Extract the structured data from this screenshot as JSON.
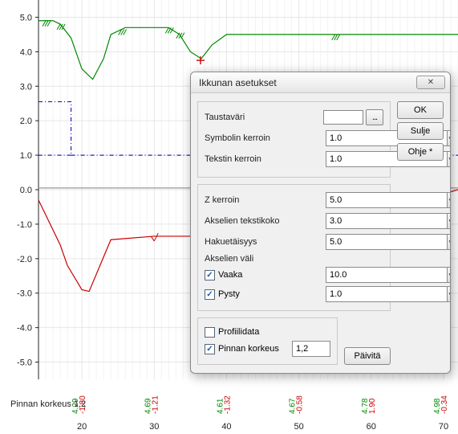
{
  "dialog": {
    "title": "Ikkunan asetukset",
    "close_glyph": "✕",
    "group1": {
      "bgcolor_label": "Taustaväri",
      "picker_glyph": "...",
      "sym_label": "Symbolin kerroin",
      "sym_value": "1.0",
      "text_label": "Tekstin kerroin",
      "text_value": "1.0"
    },
    "group2": {
      "z_label": "Z kerroin",
      "z_value": "5.0",
      "axtext_label": "Akselien tekstikoko",
      "axtext_value": "3.0",
      "search_label": "Hakuetäisyys",
      "search_value": "5.0",
      "interval_title": "Akselien väli",
      "horiz_label": "Vaaka",
      "horiz_checked": "✓",
      "horiz_value": "10.0",
      "vert_label": "Pysty",
      "vert_checked": "✓",
      "vert_value": "1.0"
    },
    "group3": {
      "profile_label": "Profiilidata",
      "profile_checked": "",
      "surface_label": "Pinnan korkeus",
      "surface_checked": "✓",
      "surface_value": "1,2"
    },
    "buttons": {
      "ok": "OK",
      "close": "Sulje",
      "help": "Ohje *",
      "update": "Päivitä"
    },
    "caret": "▼"
  },
  "bottom_label": "Pinnan korkeus 1,2",
  "chart_data": {
    "type": "line",
    "x_ticks": [
      20,
      30,
      40,
      50,
      60,
      70
    ],
    "y_ticks": [
      -5.0,
      -4.0,
      -3.0,
      -2.0,
      -1.0,
      0.0,
      1.0,
      2.0,
      3.0,
      4.0,
      5.0
    ],
    "xlim": [
      14,
      72
    ],
    "ylim": [
      -5.5,
      5.5
    ],
    "series": [
      {
        "name": "green",
        "color": "#008800",
        "x": [
          14,
          16,
          17,
          18.5,
          20,
          21.5,
          23,
          24,
          26,
          32,
          33.5,
          35,
          36.5,
          38,
          40,
          55,
          72
        ],
        "y": [
          4.9,
          4.9,
          4.8,
          4.4,
          3.5,
          3.2,
          3.8,
          4.5,
          4.7,
          4.7,
          4.5,
          4.0,
          3.8,
          4.2,
          4.5,
          4.5,
          4.5
        ]
      },
      {
        "name": "blue-dash",
        "color": "#2020c0",
        "dash": true,
        "x": [
          14,
          18.5,
          18.5,
          18.5,
          18.5,
          18.5,
          14
        ],
        "y": [
          2.55,
          2.55,
          1.75,
          1.0,
          1.0,
          1.0,
          1.0
        ]
      },
      {
        "name": "blue-dash-horiz",
        "color": "#2020c0",
        "dash": true,
        "x": [
          18.5,
          72
        ],
        "y": [
          1.0,
          1.0
        ]
      },
      {
        "name": "gray",
        "color": "#999999",
        "x": [
          14,
          72
        ],
        "y": [
          0.05,
          0.05
        ]
      },
      {
        "name": "red",
        "color": "#cc0000",
        "x": [
          14,
          17,
          18,
          20,
          21,
          24,
          30,
          50,
          72
        ],
        "y": [
          -0.3,
          -1.6,
          -2.2,
          -2.9,
          -2.95,
          -1.45,
          -1.35,
          -1.35,
          0.0
        ]
      }
    ],
    "xvalue_labels": [
      {
        "x": 20,
        "green": "4.29",
        "red": "-1.80"
      },
      {
        "x": 30,
        "green": "4.69",
        "red": "-1.21"
      },
      {
        "x": 40,
        "green": "4.61",
        "red": "-1.32"
      },
      {
        "x": 50,
        "green": "4.67",
        "red": "-0.58"
      },
      {
        "x": 60,
        "green": "4.78",
        "red": "1.90"
      },
      {
        "x": 70,
        "green": "4.98",
        "red": "-0.34"
      }
    ],
    "markers": [
      {
        "type": "plus-red",
        "x": 36.4,
        "y": 3.75
      },
      {
        "type": "tick-red",
        "x": 30.0,
        "y": -1.35
      }
    ]
  }
}
